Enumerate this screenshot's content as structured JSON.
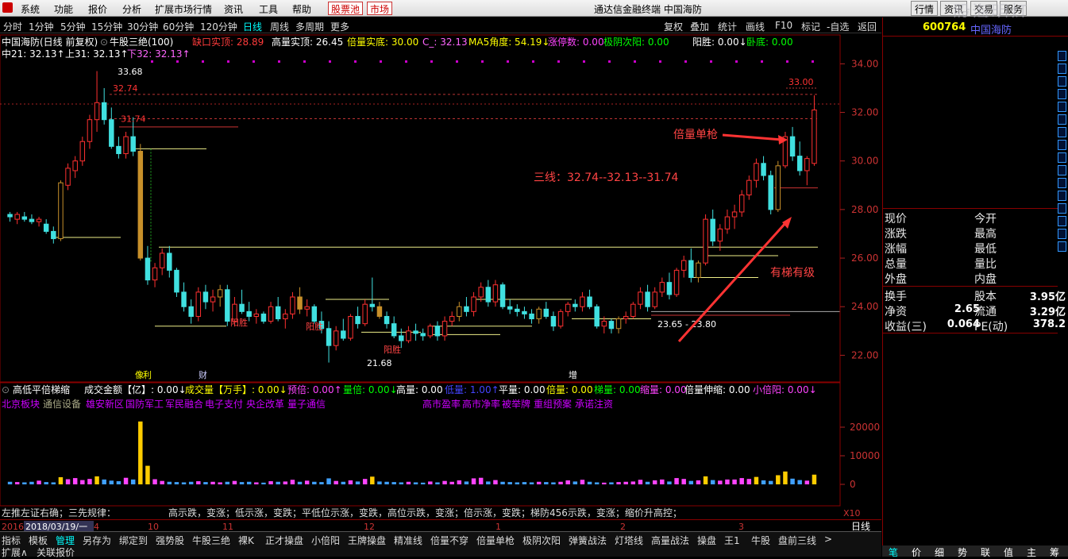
{
  "menu": [
    "系统",
    "功能",
    "报价",
    "分析",
    "扩展市场行情",
    "资讯",
    "工具",
    "帮助"
  ],
  "pool_button": "股票池",
  "market_button": "市场",
  "window_title": "通达信金融终端  中国海防",
  "right_buttons": [
    "行情",
    "资讯",
    "交易",
    "服务"
  ],
  "watermark": "股海明灯",
  "periods": [
    "分时",
    "1分钟",
    "5分钟",
    "15分钟",
    "30分钟",
    "60分钟",
    "120分钟",
    "日线",
    "周线",
    "多周期",
    "更多"
  ],
  "active_period": "日线",
  "tools": [
    "复权",
    "叠加",
    "统计",
    "画线",
    "F10",
    "标记",
    "-自选",
    "返回"
  ],
  "chart_header": {
    "name": "中国海防(日线 前复权)",
    "indicator": "牛股三绝(100)",
    "fields": [
      {
        "text": "缺口实顶: 28.89",
        "color": "#ff3b3b"
      },
      {
        "text": "高量实顶: 26.45",
        "color": "#ffffff"
      },
      {
        "text": "倍量实底: 30.00",
        "color": "#ffff00"
      },
      {
        "text": "C_: 32.13",
        "color": "#ff66ff"
      },
      {
        "text": "MA5角度: 54.19↓",
        "color": "#ffff00"
      },
      {
        "text": "涨停数: 0.00",
        "color": "#ff44ff"
      },
      {
        "text": "极阴次阳: 0.00",
        "color": "#00ff00"
      },
      {
        "text": "阳胜: 0.00↓",
        "color": "#ffffff"
      },
      {
        "text": "卧底: 0.00",
        "color": "#00ff00"
      }
    ],
    "line2": [
      {
        "text": "中21: 32.13↑",
        "color": "#ffffff"
      },
      {
        "text": "上31: 32.13↑",
        "color": "#ffffff"
      },
      {
        "text": "下32: 32.13↑",
        "color": "#ff66ff"
      }
    ]
  },
  "price_axis": [
    "34.00",
    "32.00",
    "30.00",
    "28.00",
    "26.00",
    "24.00",
    "22.00"
  ],
  "annotations": {
    "high_label": "33.68",
    "r1": "32.74",
    "r2": "31.74",
    "peak": "33.00",
    "low_label": "21.68",
    "support": "23.65 - 23.80",
    "double_volume": "倍量单枪",
    "three_lines": "三线：32.74--32.13--31.74",
    "step": "有梯有级",
    "yang1": "阳胜",
    "yang2": "阳胜",
    "yang3": "阳胜",
    "tag_xiang": "像",
    "tag_cai": "财",
    "tag_zeng": "增",
    "tag_li": "利"
  },
  "vol_header": [
    {
      "text": "高低平倍梯缩",
      "color": "#ffffff"
    },
    {
      "text": "成交金额【亿】: 0.00↓",
      "color": "#ffffff"
    },
    {
      "text": "成交量【万手】: 0.00↓",
      "color": "#ffff00"
    },
    {
      "text": "预倍: 0.00↑",
      "color": "#ff44ff"
    },
    {
      "text": "量倍: 0.00↓",
      "color": "#00ff00"
    },
    {
      "text": "高量: 0.00",
      "color": "#ffffff"
    },
    {
      "text": "低量: 1.00↑",
      "color": "#4444ff"
    },
    {
      "text": "平量: 0.00",
      "color": "#ffffff"
    },
    {
      "text": "倍量: 0.00",
      "color": "#ffff00"
    },
    {
      "text": "梯量: 0.00",
      "color": "#00ff00"
    },
    {
      "text": "缩量: 0.00",
      "color": "#ff44ff"
    },
    {
      "text": "倍量伸缩: 0.00",
      "color": "#ffffff"
    },
    {
      "text": "小倍阳: 0.00↓",
      "color": "#ff44ff"
    }
  ],
  "concepts_left": [
    "北京板块",
    "通信设备",
    "雄安新区",
    "国防军工",
    "军民融合",
    "电子支付",
    "央企改革",
    "量子通信"
  ],
  "concepts_right": [
    "高市盈率",
    "高市净率",
    "被举牌",
    "重组预案",
    "承诺注资"
  ],
  "vol_axis": [
    "20000",
    "10000",
    "0"
  ],
  "rule_text": "左推左证右确；三先规律：",
  "rule_text2": "高示跌，变涨；低示涨，变跌；平低位示涨，变跌，高位示跌，变涨；倍示涨，变跌；梯防456示跌，变涨；缩价升高控；",
  "date_labels": [
    "2016",
    "2018/03/19/一",
    "4",
    "10",
    "11",
    "12",
    "1",
    "2",
    "3"
  ],
  "x10": "X10",
  "rizhou": "日线",
  "bottom_tabs": [
    "指标",
    "模板",
    "管理",
    "另存为",
    "绑定到",
    "强势股",
    "牛股三绝",
    "裸K",
    "正才操盘",
    "小倍阳",
    "王牌操盘",
    "精准线",
    "倍量不穿",
    "倍量单枪",
    "极阴次阳",
    "弹簧战法",
    "灯塔线",
    "高量战法",
    "操盘",
    "王1",
    "牛股",
    "盘前三线",
    ">"
  ],
  "active_tab": "管理",
  "status": [
    "扩展∧",
    "关联报价"
  ],
  "right_panel": {
    "code": "600764",
    "name": "中国海防",
    "rows": [
      {
        "l": "现价",
        "r": "今开"
      },
      {
        "l": "涨跌",
        "r": "最高"
      },
      {
        "l": "涨幅",
        "r": "最低"
      },
      {
        "l": "总量",
        "r": "量比"
      },
      {
        "l": "外盘",
        "r": "内盘"
      }
    ],
    "stats": [
      {
        "l": "换手",
        "ml": "",
        "r": "股本",
        "v": "3.95亿"
      },
      {
        "l": "净资",
        "ml": "2.65",
        "r": "流通",
        "v": "3.29亿"
      },
      {
        "l": "收益(三)",
        "ml": "0.064",
        "r": "PE(动)",
        "v": "378.2"
      }
    ],
    "tabs": [
      "笔",
      "价",
      "细",
      "势",
      "联",
      "值",
      "主",
      "筹"
    ]
  },
  "chart_data": {
    "type": "candlestick",
    "ylim": [
      21.0,
      34.6
    ],
    "ohlc": [
      [
        27.8,
        27.9,
        27.5,
        27.7
      ],
      [
        27.6,
        27.9,
        27.4,
        27.8
      ],
      [
        27.7,
        27.9,
        27.5,
        27.6
      ],
      [
        27.6,
        27.8,
        27.4,
        27.5
      ],
      [
        27.5,
        27.7,
        27.3,
        27.6
      ],
      [
        27.4,
        27.6,
        27.0,
        27.1
      ],
      [
        27.1,
        27.3,
        26.6,
        26.8
      ],
      [
        26.8,
        29.2,
        26.7,
        29.1
      ],
      [
        29.0,
        29.9,
        28.8,
        29.7
      ],
      [
        29.6,
        30.2,
        29.3,
        30.0
      ],
      [
        30.0,
        31.0,
        29.8,
        30.8
      ],
      [
        30.8,
        31.9,
        30.5,
        31.7
      ],
      [
        31.7,
        33.7,
        31.2,
        32.4
      ],
      [
        32.4,
        33.0,
        31.5,
        31.7
      ],
      [
        31.7,
        32.2,
        30.5,
        30.6
      ],
      [
        30.6,
        31.0,
        30.1,
        30.3
      ],
      [
        30.3,
        31.2,
        30.1,
        31.0
      ],
      [
        31.0,
        31.8,
        30.2,
        30.4
      ],
      [
        30.4,
        30.7,
        25.9,
        26.0
      ],
      [
        26.0,
        26.5,
        24.9,
        25.1
      ],
      [
        25.1,
        25.8,
        24.8,
        25.6
      ],
      [
        25.6,
        26.4,
        25.3,
        26.2
      ],
      [
        26.2,
        26.5,
        25.2,
        25.5
      ],
      [
        25.5,
        25.6,
        24.4,
        24.6
      ],
      [
        24.6,
        25.0,
        23.8,
        24.0
      ],
      [
        24.0,
        24.3,
        23.3,
        23.6
      ],
      [
        23.6,
        24.8,
        23.4,
        24.6
      ],
      [
        24.6,
        24.9,
        23.9,
        24.2
      ],
      [
        24.2,
        24.7,
        23.8,
        24.4
      ],
      [
        24.4,
        24.9,
        24.0,
        24.7
      ],
      [
        24.7,
        24.9,
        23.2,
        23.4
      ],
      [
        23.4,
        24.4,
        23.2,
        24.1
      ],
      [
        24.1,
        24.7,
        23.7,
        23.8
      ],
      [
        23.8,
        24.2,
        23.4,
        23.6
      ],
      [
        23.6,
        23.9,
        23.3,
        23.7
      ],
      [
        23.7,
        23.8,
        23.3,
        23.4
      ],
      [
        23.4,
        24.2,
        23.3,
        24.0
      ],
      [
        24.0,
        24.4,
        23.4,
        23.5
      ],
      [
        23.5,
        23.9,
        23.1,
        23.7
      ],
      [
        23.7,
        24.6,
        23.5,
        24.4
      ],
      [
        24.4,
        24.8,
        23.7,
        23.9
      ],
      [
        23.9,
        24.3,
        23.6,
        24.0
      ],
      [
        24.0,
        24.1,
        23.3,
        23.4
      ],
      [
        23.4,
        23.8,
        22.9,
        23.1
      ],
      [
        23.1,
        23.4,
        21.7,
        22.4
      ],
      [
        22.4,
        23.2,
        22.2,
        23.0
      ],
      [
        23.0,
        23.5,
        22.6,
        22.7
      ],
      [
        22.7,
        23.7,
        22.6,
        23.6
      ],
      [
        23.6,
        24.0,
        23.1,
        23.3
      ],
      [
        23.3,
        24.3,
        23.2,
        24.1
      ],
      [
        24.1,
        25.2,
        23.8,
        24.0
      ],
      [
        24.0,
        24.2,
        23.5,
        23.6
      ],
      [
        23.6,
        23.8,
        23.1,
        23.3
      ],
      [
        23.3,
        23.6,
        22.7,
        22.8
      ],
      [
        22.8,
        23.1,
        22.3,
        22.6
      ],
      [
        22.6,
        23.2,
        22.5,
        23.0
      ],
      [
        23.0,
        23.3,
        22.6,
        22.9
      ],
      [
        22.9,
        23.1,
        22.6,
        22.8
      ],
      [
        22.8,
        23.3,
        22.7,
        23.2
      ],
      [
        23.2,
        23.4,
        22.6,
        22.8
      ],
      [
        22.8,
        23.6,
        22.6,
        23.4
      ],
      [
        23.4,
        23.8,
        23.2,
        23.6
      ],
      [
        23.6,
        24.2,
        23.4,
        24.0
      ],
      [
        24.0,
        24.4,
        23.6,
        23.8
      ],
      [
        23.8,
        24.6,
        23.6,
        24.4
      ],
      [
        24.4,
        25.0,
        24.2,
        24.8
      ],
      [
        24.8,
        25.1,
        24.0,
        24.2
      ],
      [
        24.2,
        25.1,
        24.0,
        24.9
      ],
      [
        24.9,
        25.0,
        23.9,
        24.0
      ],
      [
        24.0,
        24.3,
        23.7,
        23.9
      ],
      [
        23.9,
        24.1,
        23.6,
        23.8
      ],
      [
        23.8,
        24.0,
        23.5,
        23.7
      ],
      [
        23.7,
        23.9,
        23.3,
        23.5
      ],
      [
        23.5,
        24.0,
        23.3,
        23.9
      ],
      [
        23.9,
        24.2,
        23.5,
        23.6
      ],
      [
        23.6,
        23.8,
        23.0,
        23.2
      ],
      [
        23.2,
        23.9,
        23.1,
        23.8
      ],
      [
        23.8,
        24.2,
        23.6,
        24.1
      ],
      [
        24.1,
        24.3,
        23.8,
        24.0
      ],
      [
        24.0,
        24.6,
        23.8,
        24.4
      ],
      [
        24.4,
        24.7,
        23.9,
        24.0
      ],
      [
        24.0,
        24.1,
        23.1,
        23.2
      ],
      [
        23.2,
        23.6,
        22.9,
        23.4
      ],
      [
        23.4,
        23.5,
        22.9,
        23.1
      ],
      [
        23.1,
        23.6,
        22.9,
        23.5
      ],
      [
        23.5,
        23.8,
        23.3,
        23.6
      ],
      [
        23.6,
        24.2,
        23.5,
        24.1
      ],
      [
        24.1,
        24.8,
        23.9,
        24.6
      ],
      [
        24.6,
        24.9,
        23.8,
        24.0
      ],
      [
        24.0,
        24.8,
        23.9,
        24.6
      ],
      [
        24.6,
        25.2,
        24.4,
        25.0
      ],
      [
        25.0,
        25.4,
        24.3,
        24.5
      ],
      [
        24.5,
        25.6,
        24.4,
        25.5
      ],
      [
        25.5,
        26.1,
        25.2,
        25.9
      ],
      [
        25.9,
        26.4,
        25.0,
        25.2
      ],
      [
        25.2,
        25.9,
        25.0,
        25.8
      ],
      [
        25.8,
        27.8,
        25.7,
        27.6
      ],
      [
        27.6,
        28.0,
        26.5,
        26.7
      ],
      [
        26.7,
        27.4,
        26.3,
        27.2
      ],
      [
        27.2,
        28.0,
        27.0,
        27.7
      ],
      [
        27.7,
        28.2,
        27.2,
        27.9
      ],
      [
        27.9,
        28.8,
        27.7,
        28.6
      ],
      [
        28.6,
        29.4,
        28.4,
        29.2
      ],
      [
        29.2,
        30.1,
        28.9,
        29.9
      ],
      [
        29.9,
        30.2,
        29.2,
        29.4
      ],
      [
        29.4,
        29.6,
        27.8,
        28.0
      ],
      [
        28.0,
        30.0,
        27.9,
        29.8
      ],
      [
        29.8,
        31.2,
        29.7,
        31.0
      ],
      [
        31.0,
        31.4,
        30.0,
        30.2
      ],
      [
        30.2,
        30.8,
        29.4,
        29.6
      ],
      [
        29.6,
        30.2,
        29.0,
        30.1
      ],
      [
        29.9,
        32.7,
        29.8,
        32.1
      ]
    ],
    "volume": [
      900,
      800,
      700,
      900,
      1300,
      800,
      700,
      2500,
      1800,
      2200,
      1500,
      1900,
      2800,
      1700,
      1300,
      1100,
      2300,
      1700,
      22000,
      6500,
      1800,
      1200,
      900,
      800,
      700,
      900,
      1100,
      800,
      900,
      700,
      900,
      1200,
      800,
      900,
      700,
      600,
      1100,
      900,
      1000,
      1600,
      900,
      1300,
      900,
      800,
      2100,
      1200,
      900,
      1400,
      1000,
      1900,
      2700,
      1000,
      900,
      800,
      700,
      900,
      700,
      600,
      1000,
      700,
      1200,
      900,
      1400,
      1000,
      2100,
      2300,
      1000,
      1500,
      900,
      800,
      700,
      800,
      700,
      900,
      800,
      700,
      900,
      1400,
      1000,
      1600,
      900,
      700,
      600,
      700,
      800,
      900,
      1000,
      1600,
      900,
      1400,
      1700,
      1000,
      2200,
      1900,
      1200,
      1400,
      2800,
      1500,
      1300,
      1700,
      1700,
      2200,
      1900,
      2600,
      1400,
      1200,
      3200,
      4500,
      2000,
      1500,
      1300,
      3400
    ],
    "vol_ylim": [
      0,
      25000
    ]
  }
}
